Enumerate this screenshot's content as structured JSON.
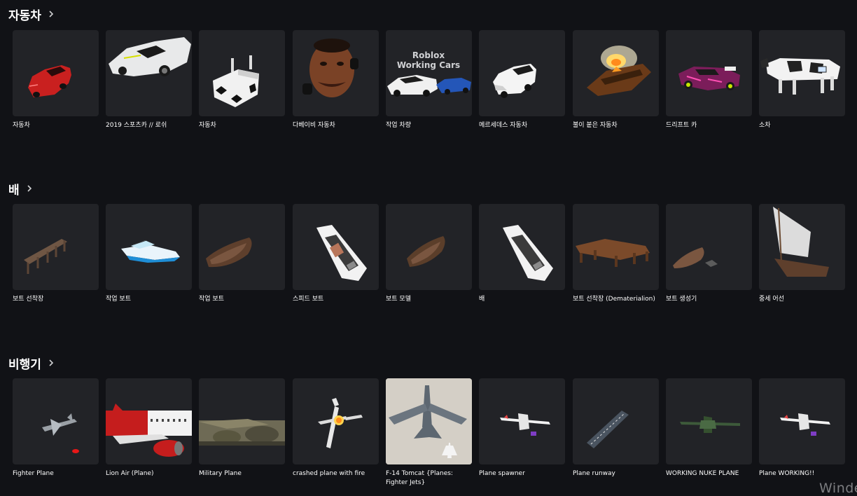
{
  "sections": [
    {
      "title": "자동차",
      "items": [
        {
          "label": "자동차",
          "icon": "red-sedan-image"
        },
        {
          "label": "2019 스포츠카 // 로쉬",
          "icon": "white-sports-car-image"
        },
        {
          "label": "자동차",
          "icon": "white-blocky-car-image"
        },
        {
          "label": "다베이비 자동차",
          "icon": "dababy-car-image"
        },
        {
          "label": "작업 차량",
          "icon": "roblox-working-cars-image",
          "overlay_text": [
            "Roblox",
            "Working Cars"
          ]
        },
        {
          "label": "메르세데스 자동차",
          "icon": "white-mercedes-image"
        },
        {
          "label": "불이 붙은 자동차",
          "icon": "burning-car-image"
        },
        {
          "label": "드리프트 카",
          "icon": "drift-car-image"
        },
        {
          "label": "소차",
          "icon": "cow-car-image"
        }
      ]
    },
    {
      "title": "배",
      "items": [
        {
          "label": "보트 선착장",
          "icon": "wooden-dock-image"
        },
        {
          "label": "작업 보트",
          "icon": "speedboat-image"
        },
        {
          "label": "작업 보트",
          "icon": "rowboat-image"
        },
        {
          "label": "스피드 보트",
          "icon": "white-speedboat-image"
        },
        {
          "label": "보트 모델",
          "icon": "rowboat-image"
        },
        {
          "label": "배",
          "icon": "white-speedboat-image"
        },
        {
          "label": "보트 선착장 (Dematerialion)",
          "icon": "wooden-pier-image"
        },
        {
          "label": "보트 생성기",
          "icon": "boat-spawner-image"
        },
        {
          "label": "중세 어선",
          "icon": "sailboat-image"
        }
      ]
    },
    {
      "title": "비행기",
      "items": [
        {
          "label": "Fighter Plane",
          "icon": "fighter-jet-image"
        },
        {
          "label": "Lion Air (Plane)",
          "icon": "airliner-image"
        },
        {
          "label": "Military Plane",
          "icon": "military-plane-image"
        },
        {
          "label": "crashed plane with fire",
          "icon": "crashed-plane-image"
        },
        {
          "label": "F-14 Tomcat {Planes: Fighter Jets}",
          "icon": "f14-tomcat-image"
        },
        {
          "label": "Plane spawner",
          "icon": "white-plane-image"
        },
        {
          "label": "Plane runway",
          "icon": "runway-image"
        },
        {
          "label": "WORKING NUKE PLANE",
          "icon": "green-plane-image"
        },
        {
          "label": "Plane WORKING!!",
          "icon": "white-plane-image"
        }
      ]
    }
  ],
  "watermark": "Winde",
  "colors": {
    "background": "#111216",
    "card": "#222327",
    "text": "#ffffff"
  }
}
